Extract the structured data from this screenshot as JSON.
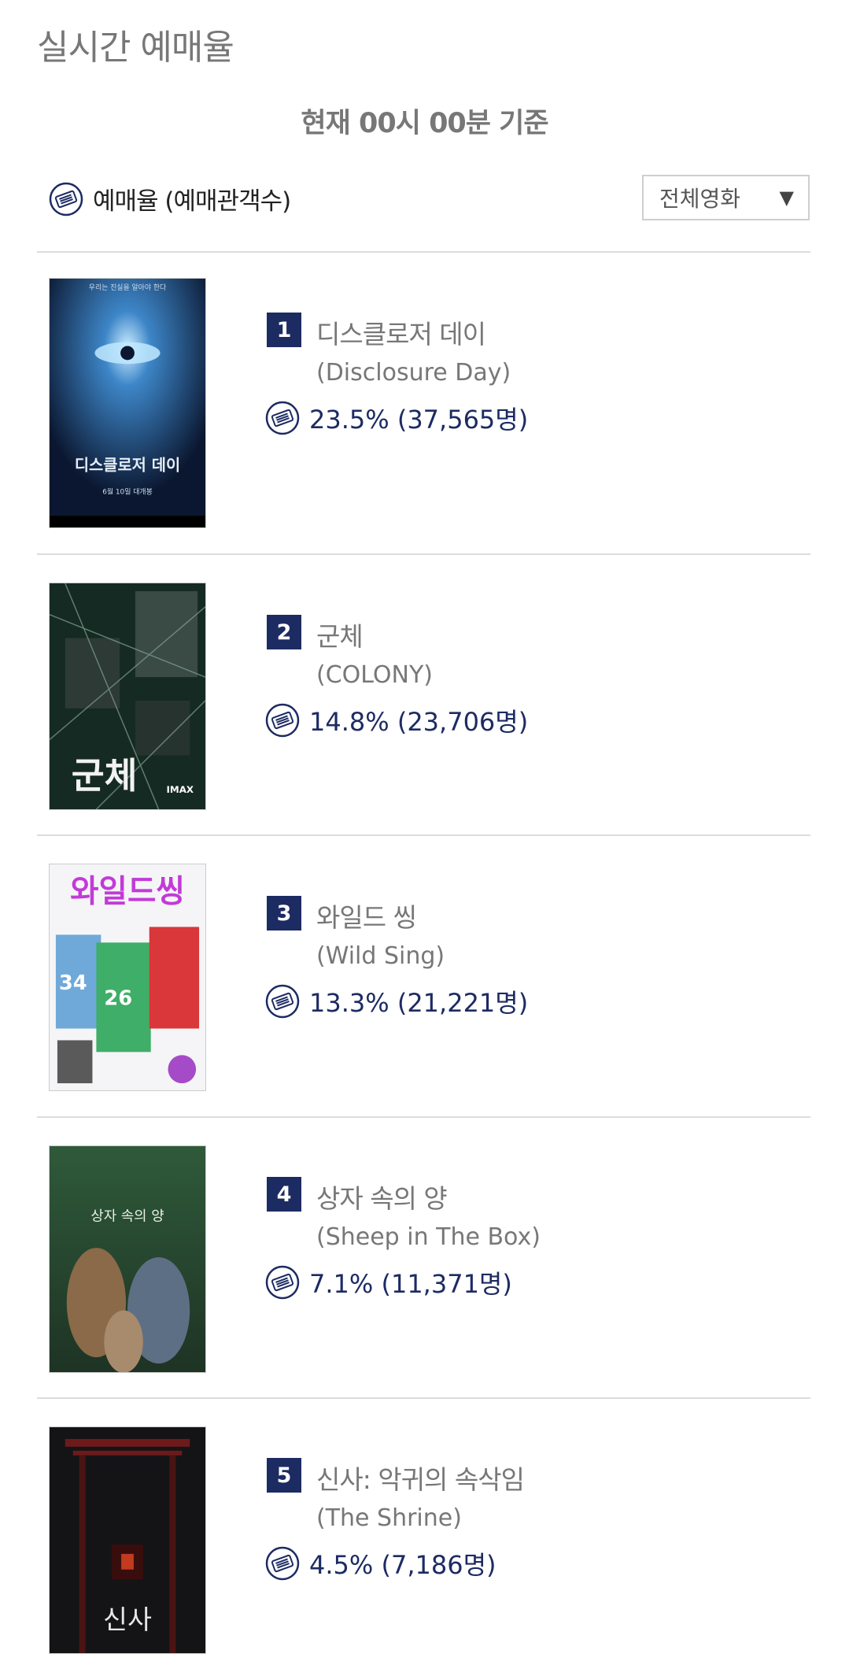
{
  "header": {
    "title": "실시간 예매율",
    "basis": "현재  00시 00분   기준"
  },
  "legend": {
    "label": "예매율 (예매관객수)",
    "icon": "ticket-icon"
  },
  "filter": {
    "selected": "전체영화",
    "arrow": "▼"
  },
  "colors": {
    "accent": "#1d2b63",
    "muted": "#777777",
    "divider": "#dcdcdc"
  },
  "movies": [
    {
      "rank": "1",
      "title_kr": "디스클로저 데이",
      "title_en": "(Disclosure Day)",
      "rate": "23.5% (37,565명)",
      "poster_text": {
        "top": "우리는 진실을 알아야 한다",
        "title": "디스클로저 데이",
        "date": "6월 10일 대개봉"
      }
    },
    {
      "rank": "2",
      "title_kr": "군체",
      "title_en": "(COLONY)",
      "rate": "14.8% (23,706명)",
      "poster_text": {
        "title": "군체",
        "badge": "IMAX"
      }
    },
    {
      "rank": "3",
      "title_kr": "와일드 씽",
      "title_en": "(Wild Sing)",
      "rate": "13.3% (21,221명)",
      "poster_text": {
        "title": "와일드씽",
        "num1": "34",
        "num2": "26"
      }
    },
    {
      "rank": "4",
      "title_kr": "상자 속의 양",
      "title_en": "(Sheep in The Box)",
      "rate": "7.1% (11,371명)",
      "poster_text": {
        "title": "상자 속의 양"
      }
    },
    {
      "rank": "5",
      "title_kr": "신사: 악귀의 속삭임",
      "title_en": "(The Shrine)",
      "rate": "4.5% (7,186명)",
      "poster_text": {
        "title": "신사"
      }
    }
  ]
}
